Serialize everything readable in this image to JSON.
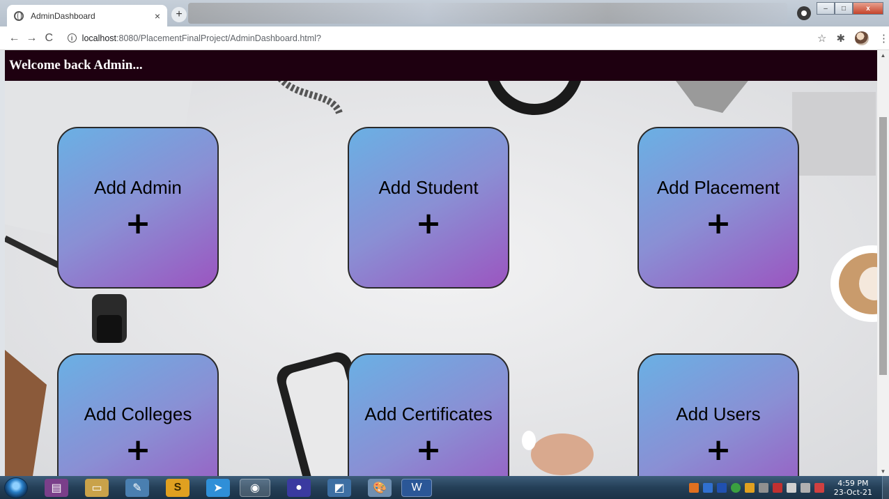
{
  "browser": {
    "tab_title": "AdminDashboard",
    "tab_close": "×",
    "new_tab": "+",
    "back": "←",
    "forward": "→",
    "reload": "C",
    "url_host": "localhost",
    "url_path": ":8080/PlacementFinalProject/AdminDashboard.html?",
    "window_min": "–",
    "window_max": "□",
    "window_close": "x"
  },
  "page": {
    "welcome": "Welcome back Admin..."
  },
  "cards": [
    {
      "label": "Add Admin",
      "plus": "+"
    },
    {
      "label": "Add Student",
      "plus": "+"
    },
    {
      "label": "Add Placement",
      "plus": "+"
    },
    {
      "label": "Add Colleges",
      "plus": "+"
    },
    {
      "label": "Add Certificates",
      "plus": "+"
    },
    {
      "label": "Add Users",
      "plus": "+"
    }
  ],
  "taskbar": {
    "time": "4:59 PM",
    "date": "23-Oct-21"
  },
  "colors": {
    "header": "#1e0010",
    "card_start": "#6ab0e4",
    "card_end": "#9b55c0"
  }
}
